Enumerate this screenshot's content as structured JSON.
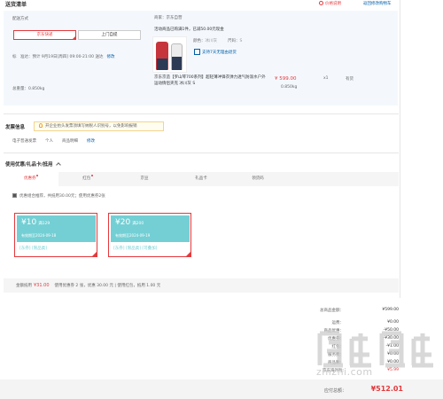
{
  "header": {
    "title": "送货清单",
    "price_link": "价格说明",
    "back_link": "返回修改购物车"
  },
  "shipping": {
    "label": "配送方式",
    "options": [
      "京东快递",
      "上门自提"
    ],
    "time_prefix": "标　准达：",
    "time_text": "预计 9月19日[周四] 09:00-21:00 送达",
    "edit": "修改",
    "weight_label": "总重量：",
    "weight_value": "0.850kg"
  },
  "product": {
    "seller": "商家：京东自营",
    "promo": "活动商品已购满1件，已减50.00元现金",
    "color_label": "颜色：",
    "color_value": "冰川灰",
    "size_label": "尺码：",
    "size_value": "S",
    "support": "支持7天无理由退货",
    "name": "京东京造【罗山琴700系列】超轻薄冲锋衣弹力透气防泼水户外运动情侣夹克 冰川灰 S",
    "price": "¥ 599.00",
    "weight": "0.850kg",
    "qty": "x1",
    "stock": "有货"
  },
  "invoice": {
    "title": "发票信息",
    "tip": "开企业抬头发票须填写纳税人识别号，以免影响报销",
    "type": "电子普通发票",
    "holder": "个人",
    "content": "商品明细",
    "edit": "修改"
  },
  "coupons": {
    "title": "使用优惠/礼品卡/抵用",
    "tabs": [
      {
        "label": "优惠券",
        "dot": true
      },
      {
        "label": "红包",
        "dot": true
      },
      {
        "label": "京豆",
        "dot": false
      },
      {
        "label": "礼品卡",
        "dot": false
      },
      {
        "label": "领货码",
        "dot": false
      }
    ],
    "combo_text": "优惠组合推荐，共抵用30.00元；使用优惠券2张",
    "items": [
      {
        "amount": "¥10",
        "condition": "满129",
        "valid": "有效期至2024-09-18",
        "limit": "[东券]  [限品类]"
      },
      {
        "amount": "¥20",
        "condition": "满200",
        "valid": "有效期至2024-09-19",
        "limit": "[东券]  [限品类]  [可叠加]"
      }
    ],
    "summary_label": "金额抵用",
    "summary_amount": "¥31.00",
    "summary_detail": "使用优惠券 2 张，优惠 30.00 元 | 使用红包，抵用 1.00 元"
  },
  "summary": {
    "rows": [
      {
        "k": "总商品金额：",
        "v": "¥599.00"
      },
      {
        "k": "运费：",
        "v": "¥0.00"
      },
      {
        "k": "商品优惠：",
        "v": "-¥50.00"
      },
      {
        "k": "优惠券：",
        "v": "-¥30.00"
      },
      {
        "k": "红包：",
        "v": "-¥1.00"
      },
      {
        "k": "服务费：",
        "v": "¥0.00"
      },
      {
        "k": "商品税：",
        "v": "¥0.00"
      },
      {
        "k": "京东海外险:",
        "v": "¥5.99"
      }
    ],
    "total_label": "应付总额：",
    "total_value": "¥512.01"
  },
  "watermark": {
    "url": "zhizhi.com"
  },
  "colors": {
    "accent": "#e4393c",
    "link": "#005ea7",
    "coupon": "#73cfd4",
    "panel": "#f4f8fd"
  }
}
